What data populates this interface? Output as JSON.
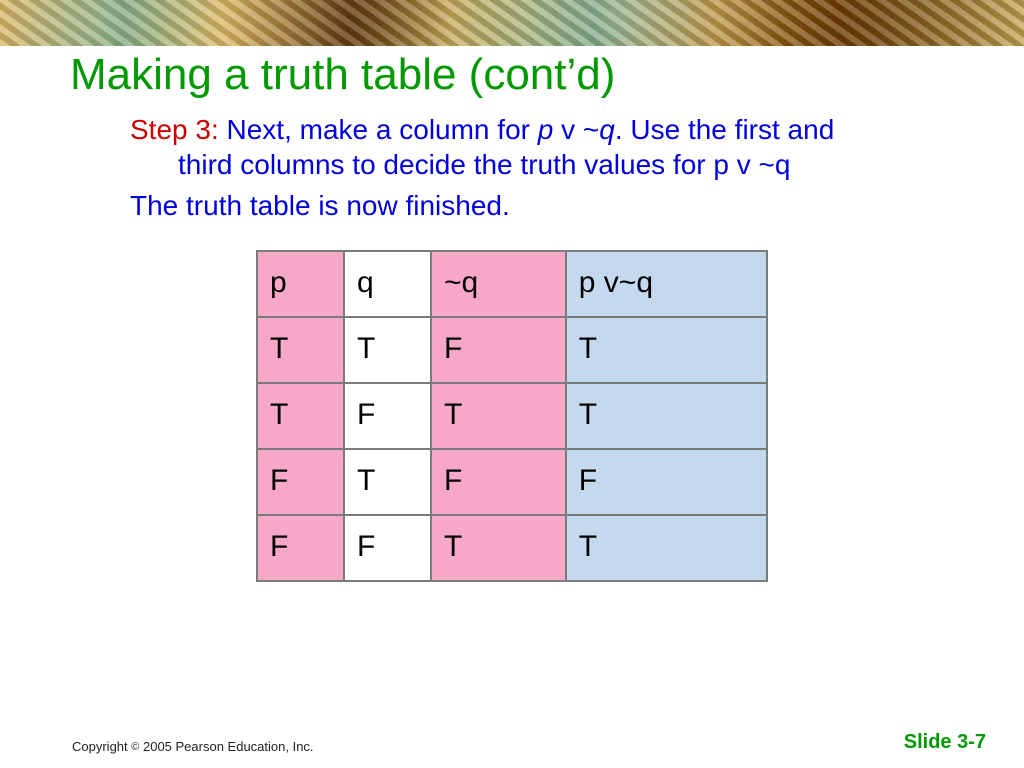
{
  "title": "Making a truth table (cont’d)",
  "step": {
    "label": "Step 3: ",
    "pre_italic": "Next, make a column for ",
    "italic1": "p",
    "mid": " v ~",
    "italic2": "q",
    "post1": ". Use the first and",
    "post2": "third columns to decide the truth values for p v ~q"
  },
  "finished": "The truth table is now finished.",
  "chart_data": {
    "type": "table",
    "columns": [
      "p",
      "q",
      "~q",
      "p v~q"
    ],
    "rows": [
      [
        "T",
        "T",
        "F",
        "T"
      ],
      [
        "T",
        "F",
        "T",
        "T"
      ],
      [
        "F",
        "T",
        "F",
        "F"
      ],
      [
        "F",
        "F",
        "T",
        "T"
      ]
    ],
    "column_colors": [
      "#f6a8c6",
      "#ffffff",
      "#f6a8c6",
      "#c4d9ee"
    ]
  },
  "footer": {
    "copyright_pre": "Copyright ",
    "copyright_symbol": "©",
    "copyright_post": " 2005 Pearson Education, Inc.",
    "slide_number": "Slide 3-7"
  },
  "colors": {
    "title_green": "#009900",
    "step_red": "#cc0000",
    "body_blue": "#0000dd",
    "pink": "#f6a8c6",
    "blue_cell": "#c4d9ee"
  }
}
